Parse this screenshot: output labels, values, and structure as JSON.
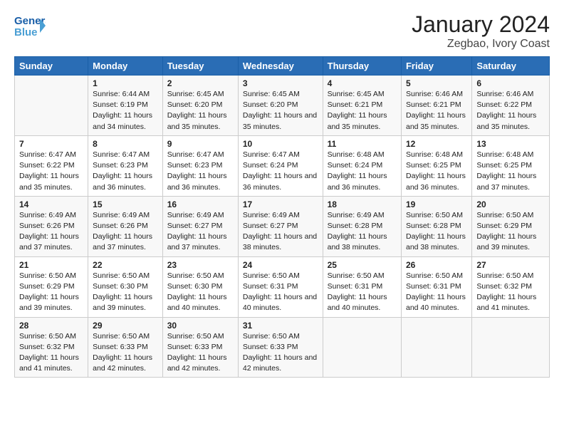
{
  "header": {
    "logo_general": "General",
    "logo_blue": "Blue",
    "month_title": "January 2024",
    "location": "Zegbao, Ivory Coast"
  },
  "days_of_week": [
    "Sunday",
    "Monday",
    "Tuesday",
    "Wednesday",
    "Thursday",
    "Friday",
    "Saturday"
  ],
  "weeks": [
    [
      {
        "day": "",
        "sunrise": "",
        "sunset": "",
        "daylight": ""
      },
      {
        "day": "1",
        "sunrise": "Sunrise: 6:44 AM",
        "sunset": "Sunset: 6:19 PM",
        "daylight": "Daylight: 11 hours and 34 minutes."
      },
      {
        "day": "2",
        "sunrise": "Sunrise: 6:45 AM",
        "sunset": "Sunset: 6:20 PM",
        "daylight": "Daylight: 11 hours and 35 minutes."
      },
      {
        "day": "3",
        "sunrise": "Sunrise: 6:45 AM",
        "sunset": "Sunset: 6:20 PM",
        "daylight": "Daylight: 11 hours and 35 minutes."
      },
      {
        "day": "4",
        "sunrise": "Sunrise: 6:45 AM",
        "sunset": "Sunset: 6:21 PM",
        "daylight": "Daylight: 11 hours and 35 minutes."
      },
      {
        "day": "5",
        "sunrise": "Sunrise: 6:46 AM",
        "sunset": "Sunset: 6:21 PM",
        "daylight": "Daylight: 11 hours and 35 minutes."
      },
      {
        "day": "6",
        "sunrise": "Sunrise: 6:46 AM",
        "sunset": "Sunset: 6:22 PM",
        "daylight": "Daylight: 11 hours and 35 minutes."
      }
    ],
    [
      {
        "day": "7",
        "sunrise": "Sunrise: 6:47 AM",
        "sunset": "Sunset: 6:22 PM",
        "daylight": "Daylight: 11 hours and 35 minutes."
      },
      {
        "day": "8",
        "sunrise": "Sunrise: 6:47 AM",
        "sunset": "Sunset: 6:23 PM",
        "daylight": "Daylight: 11 hours and 36 minutes."
      },
      {
        "day": "9",
        "sunrise": "Sunrise: 6:47 AM",
        "sunset": "Sunset: 6:23 PM",
        "daylight": "Daylight: 11 hours and 36 minutes."
      },
      {
        "day": "10",
        "sunrise": "Sunrise: 6:47 AM",
        "sunset": "Sunset: 6:24 PM",
        "daylight": "Daylight: 11 hours and 36 minutes."
      },
      {
        "day": "11",
        "sunrise": "Sunrise: 6:48 AM",
        "sunset": "Sunset: 6:24 PM",
        "daylight": "Daylight: 11 hours and 36 minutes."
      },
      {
        "day": "12",
        "sunrise": "Sunrise: 6:48 AM",
        "sunset": "Sunset: 6:25 PM",
        "daylight": "Daylight: 11 hours and 36 minutes."
      },
      {
        "day": "13",
        "sunrise": "Sunrise: 6:48 AM",
        "sunset": "Sunset: 6:25 PM",
        "daylight": "Daylight: 11 hours and 37 minutes."
      }
    ],
    [
      {
        "day": "14",
        "sunrise": "Sunrise: 6:49 AM",
        "sunset": "Sunset: 6:26 PM",
        "daylight": "Daylight: 11 hours and 37 minutes."
      },
      {
        "day": "15",
        "sunrise": "Sunrise: 6:49 AM",
        "sunset": "Sunset: 6:26 PM",
        "daylight": "Daylight: 11 hours and 37 minutes."
      },
      {
        "day": "16",
        "sunrise": "Sunrise: 6:49 AM",
        "sunset": "Sunset: 6:27 PM",
        "daylight": "Daylight: 11 hours and 37 minutes."
      },
      {
        "day": "17",
        "sunrise": "Sunrise: 6:49 AM",
        "sunset": "Sunset: 6:27 PM",
        "daylight": "Daylight: 11 hours and 38 minutes."
      },
      {
        "day": "18",
        "sunrise": "Sunrise: 6:49 AM",
        "sunset": "Sunset: 6:28 PM",
        "daylight": "Daylight: 11 hours and 38 minutes."
      },
      {
        "day": "19",
        "sunrise": "Sunrise: 6:50 AM",
        "sunset": "Sunset: 6:28 PM",
        "daylight": "Daylight: 11 hours and 38 minutes."
      },
      {
        "day": "20",
        "sunrise": "Sunrise: 6:50 AM",
        "sunset": "Sunset: 6:29 PM",
        "daylight": "Daylight: 11 hours and 39 minutes."
      }
    ],
    [
      {
        "day": "21",
        "sunrise": "Sunrise: 6:50 AM",
        "sunset": "Sunset: 6:29 PM",
        "daylight": "Daylight: 11 hours and 39 minutes."
      },
      {
        "day": "22",
        "sunrise": "Sunrise: 6:50 AM",
        "sunset": "Sunset: 6:30 PM",
        "daylight": "Daylight: 11 hours and 39 minutes."
      },
      {
        "day": "23",
        "sunrise": "Sunrise: 6:50 AM",
        "sunset": "Sunset: 6:30 PM",
        "daylight": "Daylight: 11 hours and 40 minutes."
      },
      {
        "day": "24",
        "sunrise": "Sunrise: 6:50 AM",
        "sunset": "Sunset: 6:31 PM",
        "daylight": "Daylight: 11 hours and 40 minutes."
      },
      {
        "day": "25",
        "sunrise": "Sunrise: 6:50 AM",
        "sunset": "Sunset: 6:31 PM",
        "daylight": "Daylight: 11 hours and 40 minutes."
      },
      {
        "day": "26",
        "sunrise": "Sunrise: 6:50 AM",
        "sunset": "Sunset: 6:31 PM",
        "daylight": "Daylight: 11 hours and 40 minutes."
      },
      {
        "day": "27",
        "sunrise": "Sunrise: 6:50 AM",
        "sunset": "Sunset: 6:32 PM",
        "daylight": "Daylight: 11 hours and 41 minutes."
      }
    ],
    [
      {
        "day": "28",
        "sunrise": "Sunrise: 6:50 AM",
        "sunset": "Sunset: 6:32 PM",
        "daylight": "Daylight: 11 hours and 41 minutes."
      },
      {
        "day": "29",
        "sunrise": "Sunrise: 6:50 AM",
        "sunset": "Sunset: 6:33 PM",
        "daylight": "Daylight: 11 hours and 42 minutes."
      },
      {
        "day": "30",
        "sunrise": "Sunrise: 6:50 AM",
        "sunset": "Sunset: 6:33 PM",
        "daylight": "Daylight: 11 hours and 42 minutes."
      },
      {
        "day": "31",
        "sunrise": "Sunrise: 6:50 AM",
        "sunset": "Sunset: 6:33 PM",
        "daylight": "Daylight: 11 hours and 42 minutes."
      },
      {
        "day": "",
        "sunrise": "",
        "sunset": "",
        "daylight": ""
      },
      {
        "day": "",
        "sunrise": "",
        "sunset": "",
        "daylight": ""
      },
      {
        "day": "",
        "sunrise": "",
        "sunset": "",
        "daylight": ""
      }
    ]
  ]
}
